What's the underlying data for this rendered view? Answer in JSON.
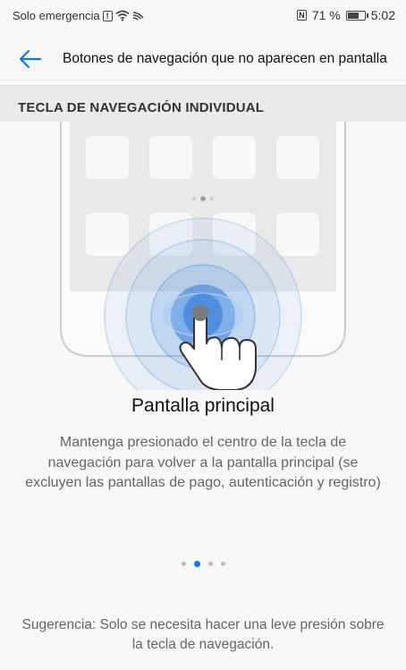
{
  "status_bar": {
    "carrier": "Solo emergencia",
    "nfc": "N",
    "battery": "71 %",
    "battery_level": 0.71,
    "time": "5:02",
    "icons": [
      "alert-icon",
      "wifi-icon",
      "signal-icon",
      "nfc-icon",
      "battery-icon"
    ]
  },
  "app_bar": {
    "back_icon": "arrow-left-icon",
    "title": "Botones de navegación que no aparecen en pantalla"
  },
  "section": {
    "title": "TECLA DE NAVEGACIÓN INDIVIDUAL"
  },
  "feature": {
    "title": "Pantalla principal",
    "description": "Mantenga presionado el centro de la tecla de navegación para volver a la pantalla principal (se excluyen las pantallas de pago, autenticación y registro)"
  },
  "pager": {
    "count": 4,
    "active": 1
  },
  "tip": "Sugerencia: Solo se necesita hacer una leve presión sobre la tecla de navegación.",
  "colors": {
    "accent": "#1a73d9",
    "ripple": "#4a90e2",
    "background": "#f7f7f7",
    "section_bg": "#eaeaea"
  }
}
